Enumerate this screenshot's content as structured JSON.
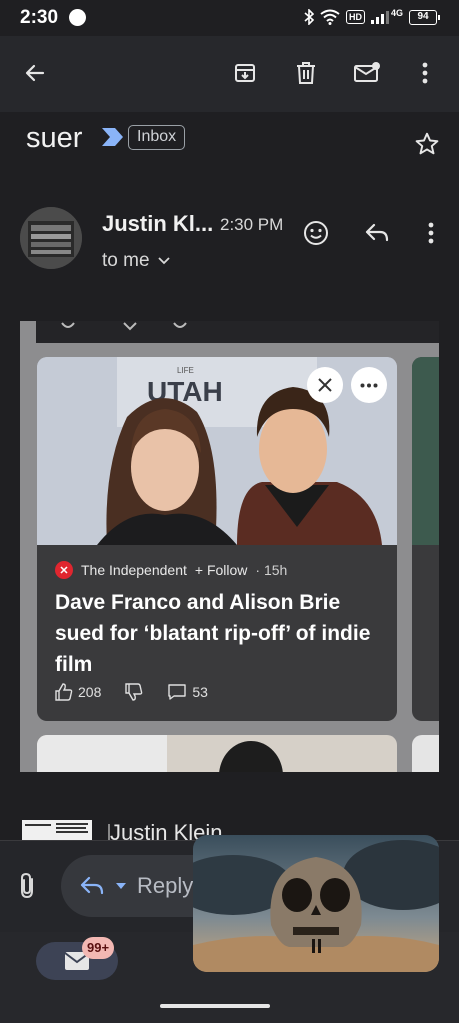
{
  "status_bar": {
    "time": "2:30",
    "network": "4G",
    "battery": "94",
    "hd": "HD"
  },
  "toolbar": {
    "back_icon": "arrow-left-icon",
    "archive_icon": "archive-icon",
    "delete_icon": "trash-icon",
    "mark_unread_icon": "mail-unread-icon",
    "more_icon": "more-vert-icon"
  },
  "email": {
    "subject": "suer",
    "label": "Inbox",
    "sender_name": "Justin Kl...",
    "time": "2:30 PM",
    "recipient": "to me"
  },
  "news_card": {
    "source": "The Independent",
    "follow": "+ Follow",
    "age": "· 15h",
    "title": "Dave Franco and Alison Brie sued for ‘blatant rip-off’ of indie film",
    "likes": "208",
    "comments": "53",
    "photo_sign_top": "LIFE",
    "photo_sign_main": "UTAH"
  },
  "quoted": {
    "sender": "Justin Klein"
  },
  "reply_bar": {
    "reply_label": "Reply"
  },
  "bottom_nav": {
    "mail_badge": "99+"
  }
}
